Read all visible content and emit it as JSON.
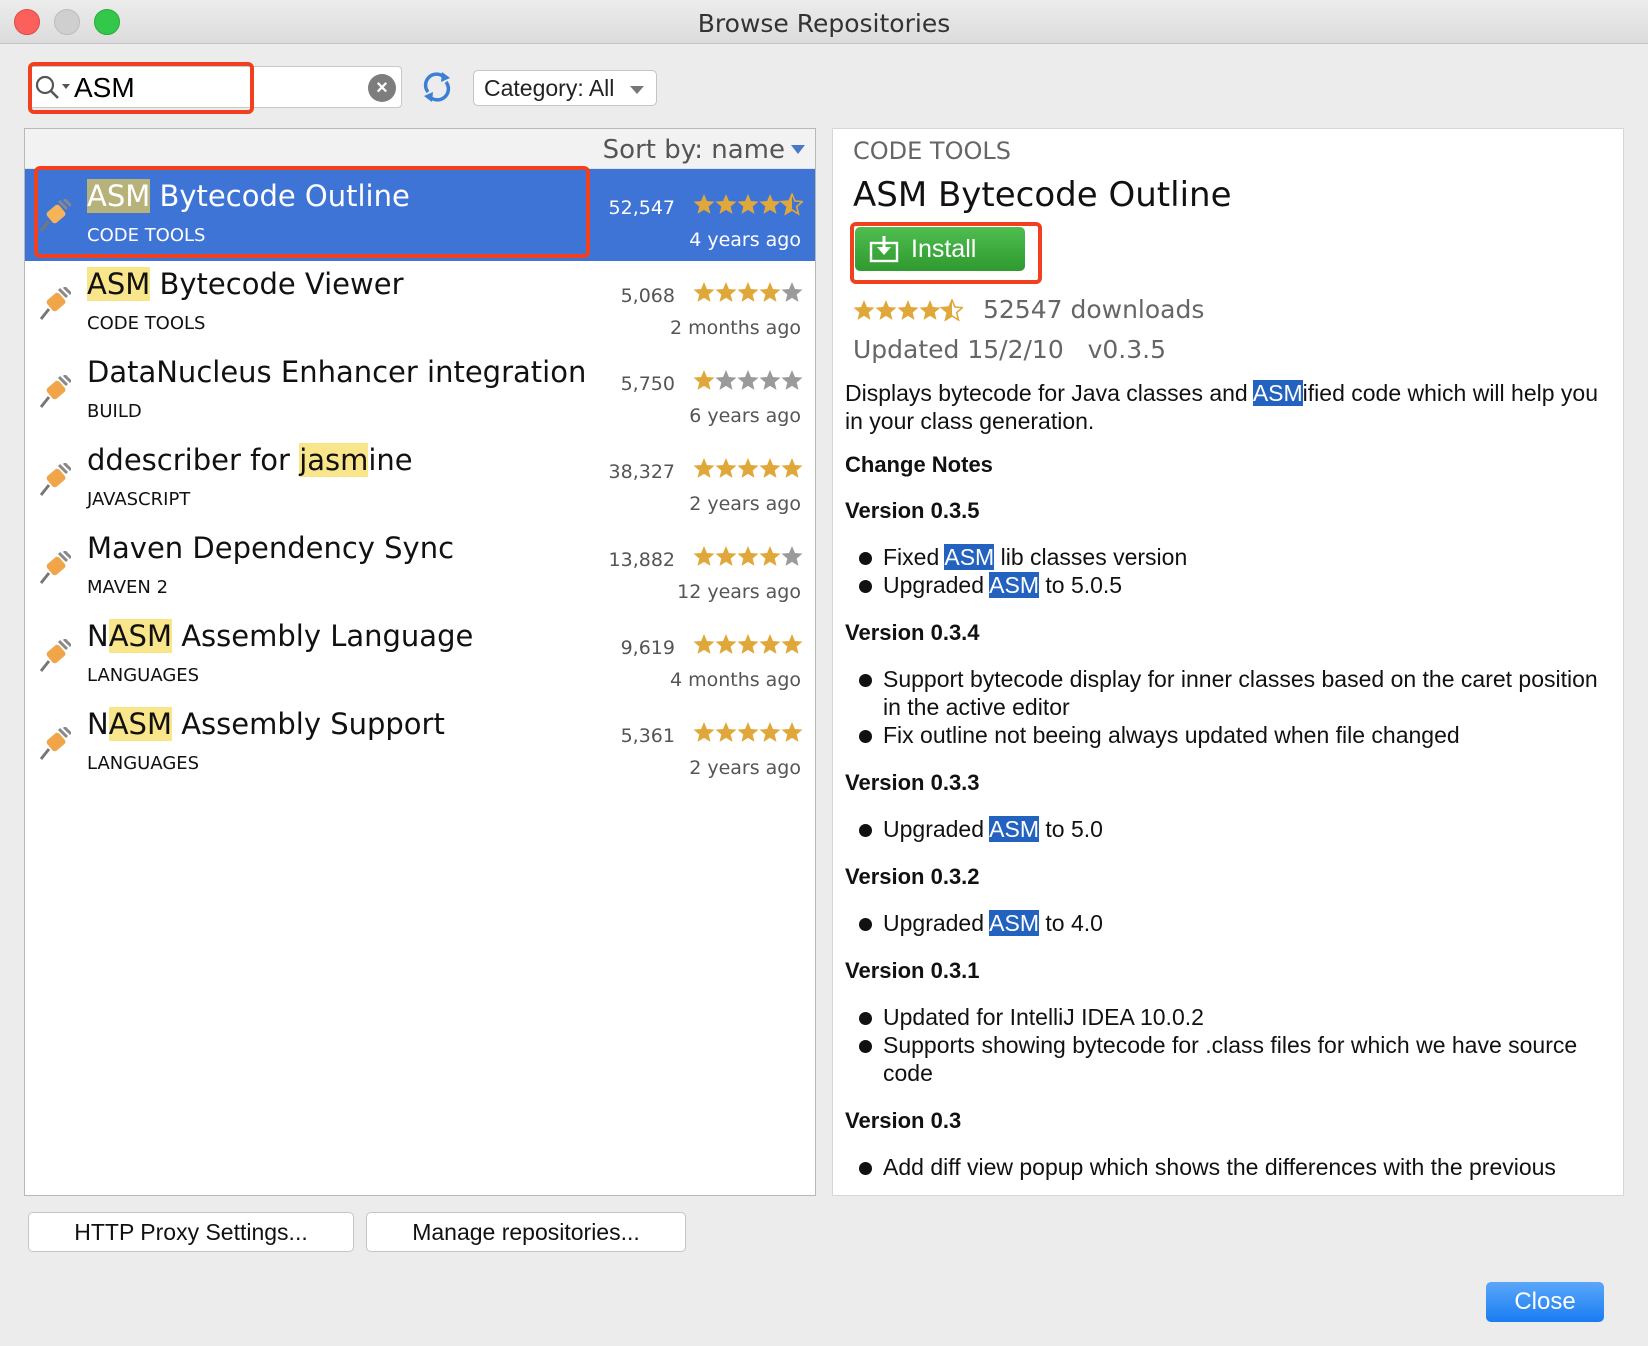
{
  "window": {
    "title": "Browse Repositories"
  },
  "toolbar": {
    "search_value": "ASM",
    "category_label": "Category: All"
  },
  "list": {
    "sort_label": "Sort by: name",
    "plugins": [
      {
        "prefix": "",
        "match": "ASM",
        "suffix": " Bytecode Outline",
        "category": "CODE TOOLS",
        "downloads": "52,547",
        "time": "4 years ago",
        "rating": 4.5
      },
      {
        "prefix": "",
        "match": "ASM",
        "suffix": " Bytecode Viewer",
        "category": "CODE TOOLS",
        "downloads": "5,068",
        "time": "2 months ago",
        "rating": 4
      },
      {
        "prefix": "DataNucleus Enhancer integration",
        "match": "",
        "suffix": "",
        "category": "BUILD",
        "downloads": "5,750",
        "time": "6 years ago",
        "rating": 1
      },
      {
        "prefix": "ddescriber for ",
        "match": "jasm",
        "suffix": "ine",
        "category": "JAVASCRIPT",
        "downloads": "38,327",
        "time": "2 years ago",
        "rating": 5
      },
      {
        "prefix": "Maven Dependency Sync",
        "match": "",
        "suffix": "",
        "category": "MAVEN 2",
        "downloads": "13,882",
        "time": "12 years ago",
        "rating": 4
      },
      {
        "prefix": "N",
        "match": "ASM",
        "suffix": " Assembly Language",
        "category": "LANGUAGES",
        "downloads": "9,619",
        "time": "4 months ago",
        "rating": 5
      },
      {
        "prefix": "N",
        "match": "ASM",
        "suffix": " Assembly Support",
        "category": "LANGUAGES",
        "downloads": "5,361",
        "time": "2 years ago",
        "rating": 5
      }
    ]
  },
  "detail": {
    "category": "CODE TOOLS",
    "title": "ASM Bytecode Outline",
    "install_label": "Install",
    "rating": 4.5,
    "downloads": "52547 downloads",
    "updated": "Updated 15/2/10   v0.3.5",
    "description": {
      "before": "Displays bytecode for Java classes and ",
      "match": "ASM",
      "after": "ified code which will help you in your class generation."
    },
    "change_notes_label": "Change Notes",
    "versions": [
      {
        "label": "Version 0.3.5",
        "items": [
          {
            "before": "Fixed ",
            "match": "ASM",
            "after": " lib classes version"
          },
          {
            "before": "Upgraded ",
            "match": "ASM",
            "after": " to 5.0.5"
          }
        ]
      },
      {
        "label": "Version 0.3.4",
        "items": [
          {
            "before": "Support bytecode display for inner classes based on the caret position in the active editor",
            "match": "",
            "after": ""
          },
          {
            "before": "Fix outline not beeing always updated when file changed",
            "match": "",
            "after": ""
          }
        ]
      },
      {
        "label": "Version 0.3.3",
        "items": [
          {
            "before": "Upgraded ",
            "match": "ASM",
            "after": " to 5.0"
          }
        ]
      },
      {
        "label": "Version 0.3.2",
        "items": [
          {
            "before": "Upgraded ",
            "match": "ASM",
            "after": " to 4.0"
          }
        ]
      },
      {
        "label": "Version 0.3.1",
        "items": [
          {
            "before": "Updated for IntelliJ IDEA 10.0.2",
            "match": "",
            "after": ""
          },
          {
            "before": "Supports showing bytecode for .class files for which we have source code",
            "match": "",
            "after": ""
          }
        ]
      },
      {
        "label": "Version 0.3",
        "items": [
          {
            "before": "Add diff view popup which shows the differences with the previous",
            "match": "",
            "after": ""
          }
        ]
      }
    ]
  },
  "footer": {
    "proxy_label": "HTTP Proxy Settings...",
    "manage_label": "Manage repositories...",
    "close_label": "Close"
  },
  "colors": {
    "accent": "#3e74d6",
    "highlight": "#f0401f",
    "install": "#2f9a2f",
    "star": "#e0a83a"
  }
}
